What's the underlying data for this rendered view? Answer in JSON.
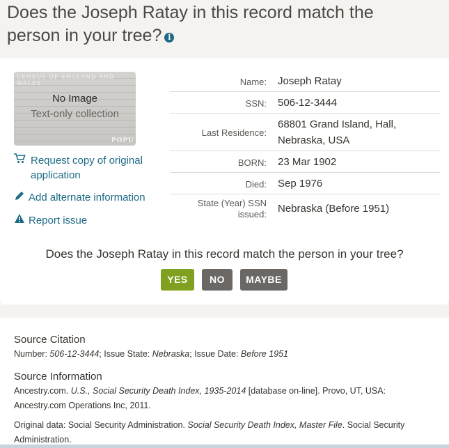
{
  "header": {
    "question_line1": "Does the Joseph Ratay in this record match the",
    "question_line2": "person in your tree?",
    "info_icon": "i"
  },
  "thumbnail": {
    "census_text": "CENSUS OF ENGLAND AND WALES",
    "popu_text": "POPU",
    "no_image": "No Image",
    "text_only": "Text-only collection"
  },
  "actions": {
    "request_copy": "Request copy of original application",
    "add_alternate": "Add alternate information",
    "report_issue": "Report issue"
  },
  "record": [
    {
      "label": "Name:",
      "value": "Joseph Ratay"
    },
    {
      "label": "SSN:",
      "value": "506-12-3444"
    },
    {
      "label": "Last Residence:",
      "value": "68801 Grand Island, Hall, Nebraska, USA"
    },
    {
      "label": "BORN:",
      "value": "23 Mar 1902"
    },
    {
      "label": "Died:",
      "value": "Sep 1976"
    },
    {
      "label": "State (Year) SSN issued:",
      "value": "Nebraska (Before 1951)"
    }
  ],
  "match": {
    "prompt": "Does the Joseph Ratay in this record match the person in your tree?",
    "yes": "YES",
    "no": "NO",
    "maybe": "MAYBE"
  },
  "source": {
    "citation_heading": "Source Citation",
    "citation_number_label": "Number: ",
    "citation_number": "506-12-3444",
    "citation_state_label": "; Issue State: ",
    "citation_state": "Nebraska",
    "citation_date_label": "; Issue Date: ",
    "citation_date": "Before 1951",
    "info_heading": "Source Information",
    "info_prefix": "Ancestry.com. ",
    "info_title": "U.S., Social Security Death Index, 1935-2014",
    "info_suffix": " [database on-line]. Provo, UT, USA: Ancestry.com Operations Inc, 2011.",
    "original_prefix": "Original data: Social Security Administration. ",
    "original_title": "Social Security Death Index, Master File",
    "original_suffix": ". Social Security Administration."
  },
  "colors": {
    "accent_link": "#1c6a86",
    "yes_button": "#7fa11f",
    "no_button": "#6a6764",
    "maybe_button": "#6a6764"
  }
}
